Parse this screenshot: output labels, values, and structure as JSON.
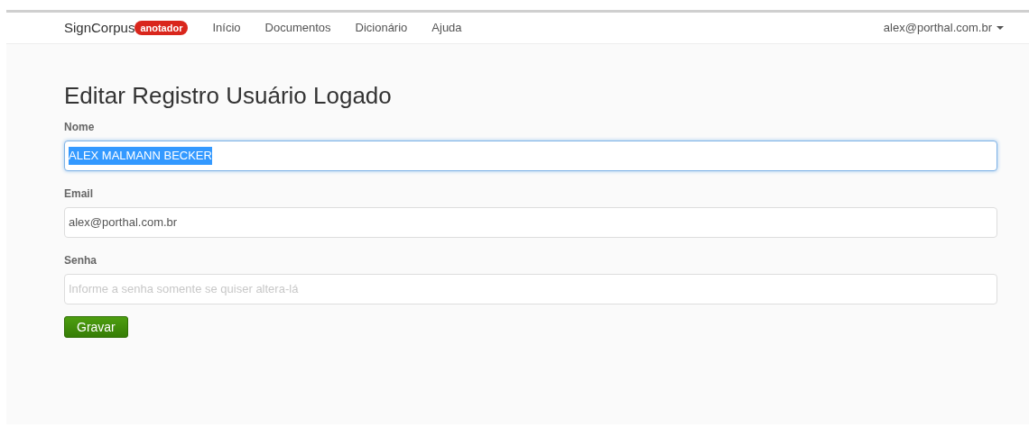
{
  "navbar": {
    "brand": "SignCorpus",
    "badge": "anotador",
    "links": [
      "Início",
      "Documentos",
      "Dicionário",
      "Ajuda"
    ],
    "user": "alex@porthal.com.br"
  },
  "heading": "Editar Registro Usuário Logado",
  "fields": [
    {
      "label": "Nome",
      "value": "ALEX MALMANN BECKER",
      "focused": true
    },
    {
      "label": "Email",
      "value": "alex@porthal.com.br",
      "focused": false
    },
    {
      "label": "Senha",
      "placeholder": "Informe a senha somente se quiser altera-lá",
      "focused": false
    }
  ],
  "submit": "Gravar"
}
